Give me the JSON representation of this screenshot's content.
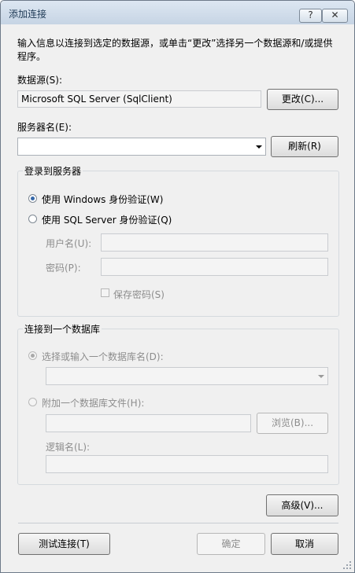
{
  "window": {
    "title": "添加连接",
    "help_label": "?",
    "close_label": "✕"
  },
  "description": "输入信息以连接到选定的数据源，或单击“更改”选择另一个数据源和/或提供程序。",
  "datasource": {
    "label": "数据源(S):",
    "value": "Microsoft SQL Server (SqlClient)",
    "change_label": "更改(C)..."
  },
  "server": {
    "label": "服务器名(E):",
    "value": "",
    "refresh_label": "刷新(R)"
  },
  "login": {
    "legend": "登录到服务器",
    "windows_auth": "使用 Windows 身份验证(W)",
    "sql_auth": "使用 SQL Server 身份验证(Q)",
    "username_label": "用户名(U):",
    "password_label": "密码(P):",
    "save_password": "保存密码(S)"
  },
  "database": {
    "legend": "连接到一个数据库",
    "select_db": "选择或输入一个数据库名(D):",
    "attach_file": "附加一个数据库文件(H):",
    "browse_label": "浏览(B)...",
    "logical_name": "逻辑名(L):"
  },
  "buttons": {
    "advanced": "高级(V)...",
    "test": "测试连接(T)",
    "ok": "确定",
    "cancel": "取消"
  }
}
